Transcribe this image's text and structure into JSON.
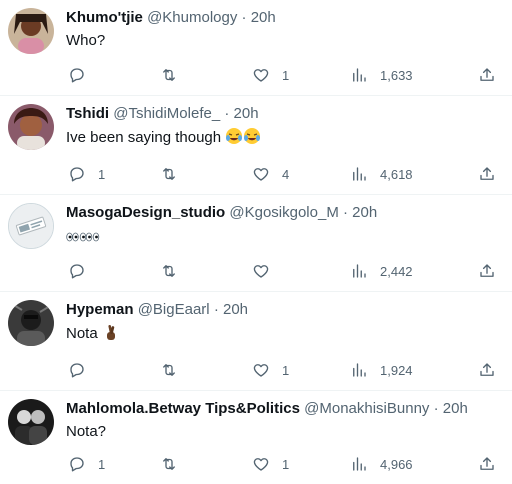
{
  "tweets": [
    {
      "name": "Khumo'tjie",
      "handle": "@Khumology",
      "dot": "·",
      "time": "20h",
      "text": "Who?",
      "replies": "",
      "retweets": "",
      "likes": "1",
      "views": "1,633"
    },
    {
      "name": "Tshidi",
      "handle": "@TshidiMolefe_",
      "dot": "·",
      "time": "20h",
      "text": "Ive been saying though",
      "replies": "1",
      "retweets": "",
      "likes": "4",
      "views": "4,618"
    },
    {
      "name": "MasogaDesign_studio",
      "handle": "@Kgosikgolo_M",
      "dot": "·",
      "time": "20h",
      "text": "",
      "replies": "",
      "retweets": "",
      "likes": "",
      "views": "2,442"
    },
    {
      "name": "Hypeman",
      "handle": "@BigEaarl",
      "dot": "·",
      "time": "20h",
      "text": "Nota",
      "replies": "",
      "retweets": "",
      "likes": "1",
      "views": "1,924"
    },
    {
      "name": "Mahlomola.Betway Tips&Politics",
      "handle": "@MonakhisiBunny",
      "dot": "·",
      "time": "20h",
      "text": "Nota?",
      "replies": "1",
      "retweets": "",
      "likes": "1",
      "views": "4,966"
    }
  ],
  "icons": {
    "reply": "reply-icon",
    "retweet": "retweet-icon",
    "like": "heart-icon",
    "views": "views-icon",
    "share": "share-icon"
  },
  "colors": {
    "text": "#0f1419",
    "muted": "#536471",
    "divider": "#eff3f4"
  }
}
